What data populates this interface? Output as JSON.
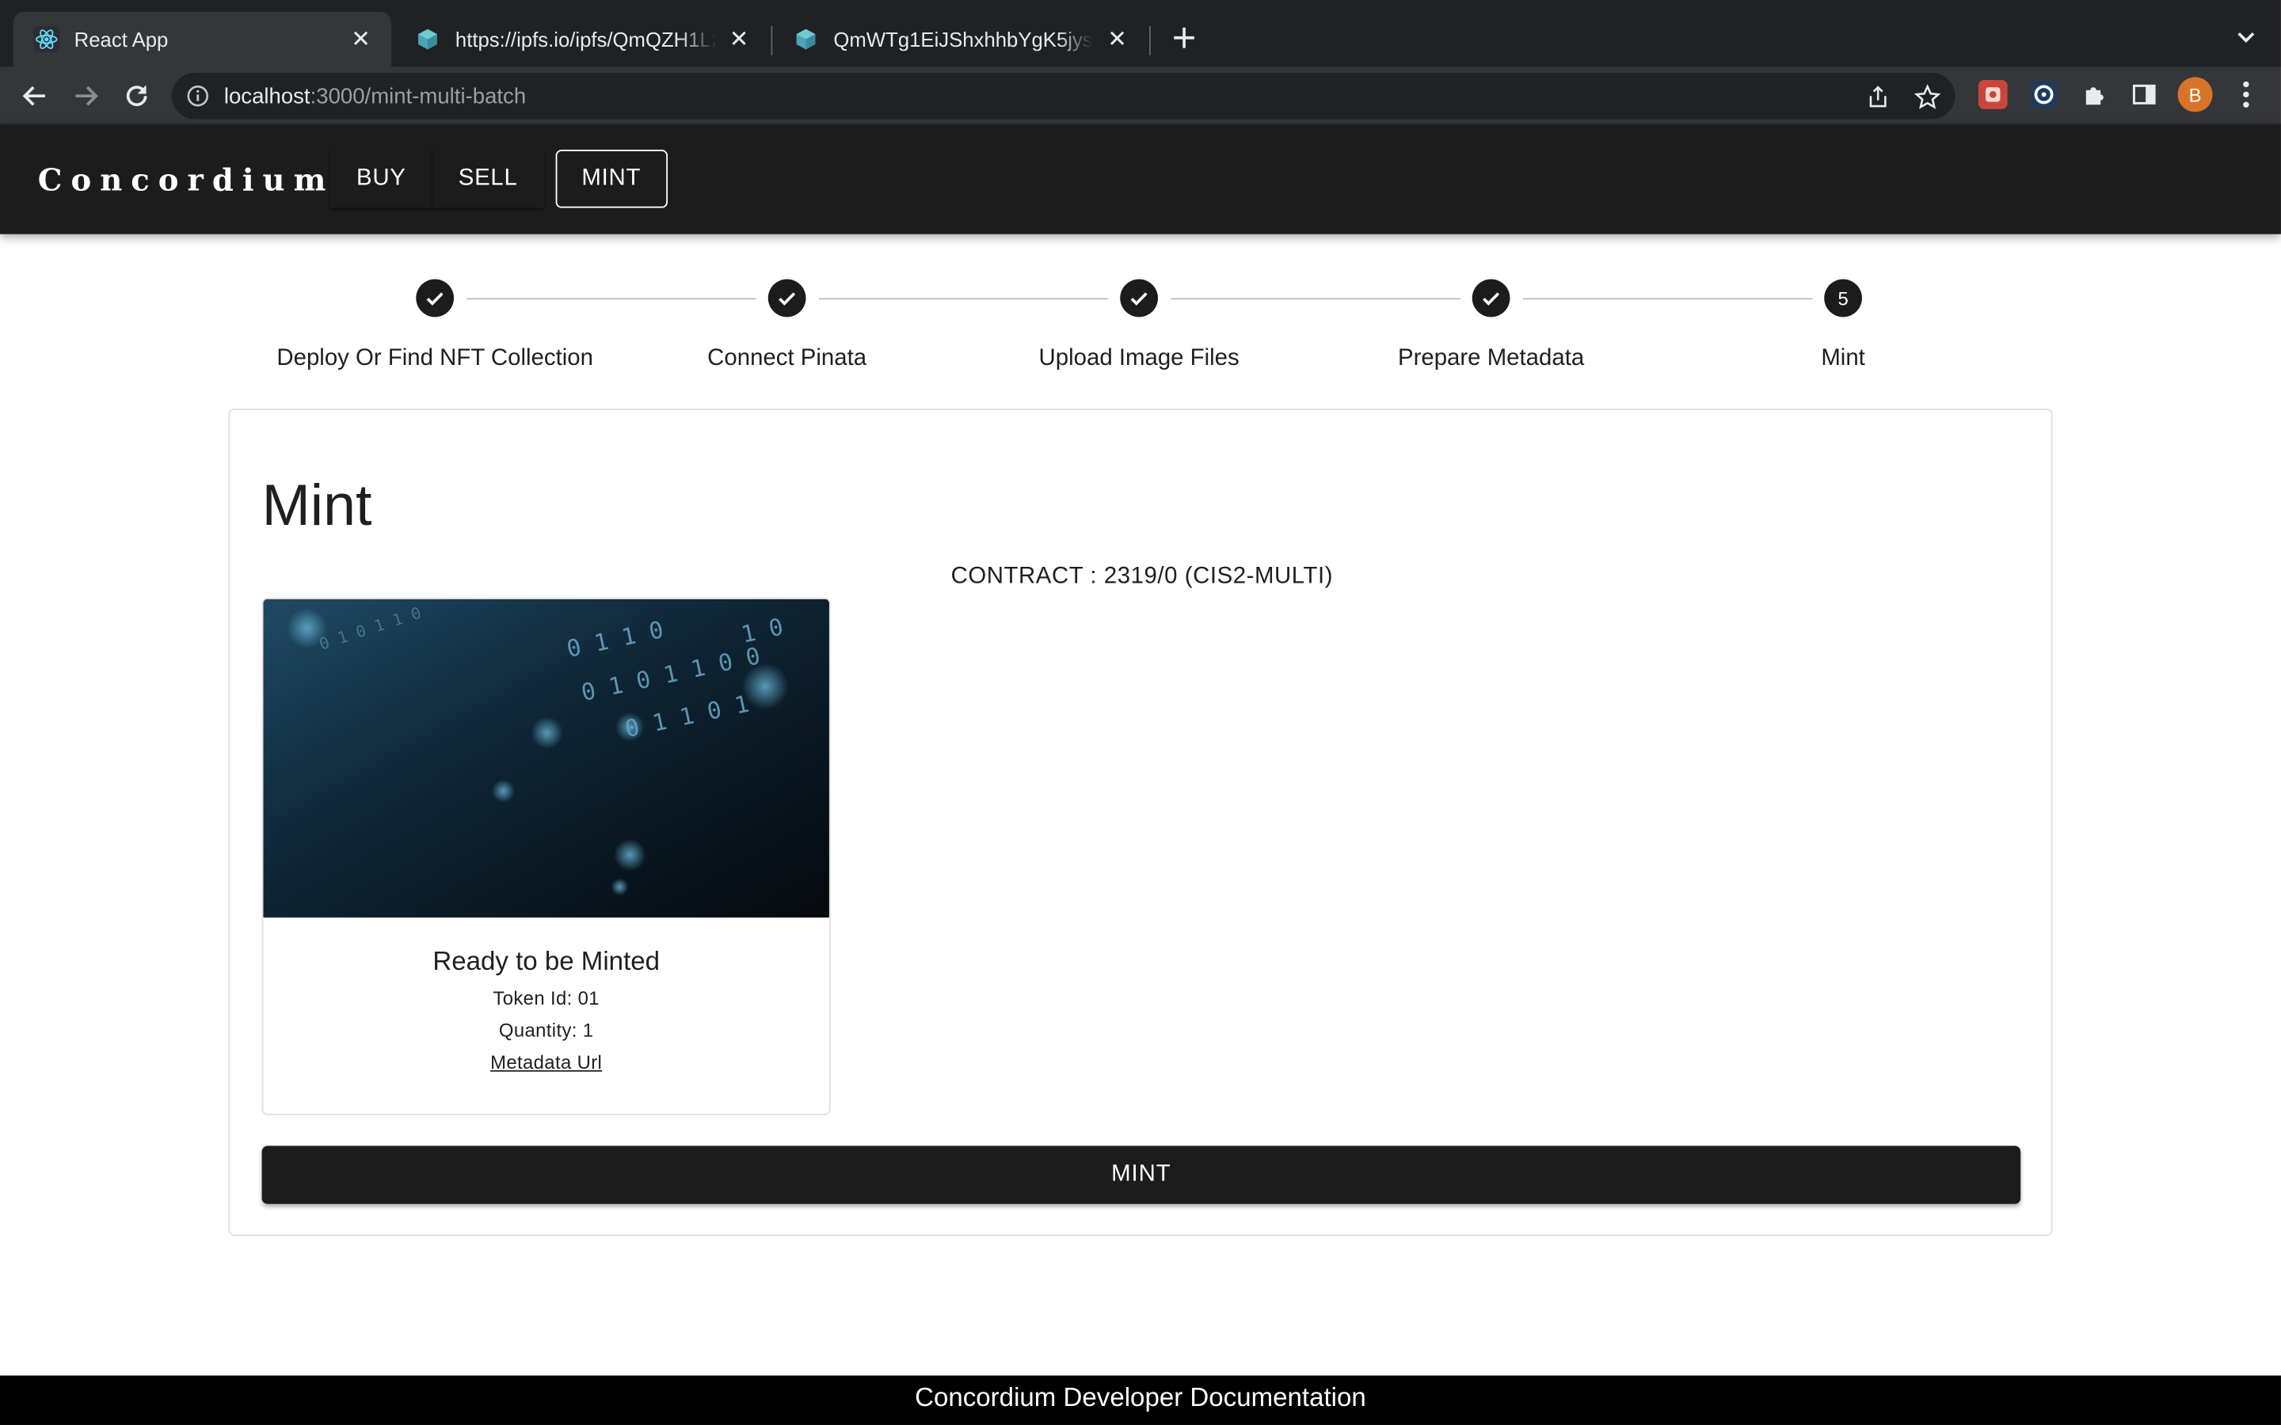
{
  "browser": {
    "tabs": [
      {
        "title": "React App",
        "favicon": "react-icon",
        "active": true
      },
      {
        "title": "https://ipfs.io/ipfs/QmQZH1LzC",
        "favicon": "ipfs-cube-icon",
        "active": false
      },
      {
        "title": "QmWTg1EiJShxhhbYgK5jysXSY",
        "favicon": "ipfs-cube-icon",
        "active": false
      }
    ],
    "url_host": "localhost",
    "url_path": ":3000/mint-multi-batch",
    "profile_initial": "B"
  },
  "app": {
    "brand": "Concordium",
    "nav": [
      {
        "label": "BUY"
      },
      {
        "label": "SELL"
      },
      {
        "label": "MINT",
        "selected": true
      }
    ]
  },
  "stepper": {
    "steps": [
      {
        "label": "Deploy Or Find NFT Collection",
        "completed": true,
        "number": ""
      },
      {
        "label": "Connect Pinata",
        "completed": true,
        "number": ""
      },
      {
        "label": "Upload Image Files",
        "completed": true,
        "number": ""
      },
      {
        "label": "Prepare Metadata",
        "completed": true,
        "number": ""
      },
      {
        "label": "Mint",
        "completed": false,
        "number": "5"
      }
    ]
  },
  "main": {
    "title": "Mint",
    "contract": "CONTRACT : 2319/0 (CIS2-MULTI)",
    "token": {
      "status": "Ready to be Minted",
      "token_id": "Token Id: 01",
      "quantity": "Quantity: 1",
      "metadata_link": "Metadata Url"
    },
    "mint_button": "MINT"
  },
  "footer": {
    "text": "Concordium Developer Documentation"
  },
  "colors": {
    "appbar": "#1c1c1c",
    "chrome_dark": "#202124",
    "chrome_toolbar": "#35363a",
    "profile": "#d8742a",
    "footer": "#000000"
  }
}
